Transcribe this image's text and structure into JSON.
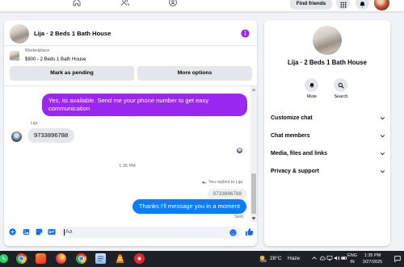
{
  "colors": {
    "page_background": "#f0f2f5",
    "messenger_purple": "#9b28f0",
    "messenger_blue": "#0a7cff",
    "incoming_bubble": "#e4e6eb",
    "icon_blue": "#0866ff",
    "taskbar": "#1d2126"
  },
  "topbar": {
    "nav_icons": [
      "home-icon",
      "friends-icon",
      "groups-icon"
    ],
    "find_friends_label": "Find friends",
    "right_icons": [
      "menu-grid-icon",
      "notifications-bell-icon",
      "profile-avatar"
    ]
  },
  "chat": {
    "title": "Lija · 2 Beds 1 Bath House",
    "marketplace_label": "Marketplace",
    "listing_text": "$800 - 2 Beds 1 Bath House",
    "mark_pending_label": "Mark as pending",
    "more_options_label": "More options",
    "messages": [
      {
        "text": "Yes, its available. Send me your phone number to get easy communication"
      },
      {
        "sender": "Lija",
        "text": "9733896788"
      },
      {
        "timestamp": "1:35 PM"
      },
      {
        "reply_notice": "You replied to Lija",
        "quoted_text": "9733896788",
        "text": "Thanks I'll message you in a moment",
        "status": "Sent"
      }
    ],
    "composer_placeholder": "Aa",
    "composer_icons": [
      "add-circle-icon",
      "image-icon",
      "sticker-icon",
      "gif-icon",
      "emoji-icon",
      "thumbs-up-icon"
    ]
  },
  "details": {
    "title": "Lija · 2 Beds 1 Bath House",
    "mute_label": "Mute",
    "search_label": "Search",
    "sections": [
      "Customize chat",
      "Chat members",
      "Media, files and links",
      "Privacy & support"
    ]
  },
  "taskbar": {
    "apps": [
      "whatsapp-icon",
      "chrome-icon",
      "brave-icon",
      "firefox-icon",
      "chrome-icon",
      "notepad-icon",
      "vlc-icon",
      "red-app-icon"
    ],
    "weather_temp": "28°C",
    "weather_condition": "Haze",
    "language_line1": "ENG",
    "language_line2": "IN",
    "time": "1:35 PM",
    "date": "3/27/2025"
  }
}
